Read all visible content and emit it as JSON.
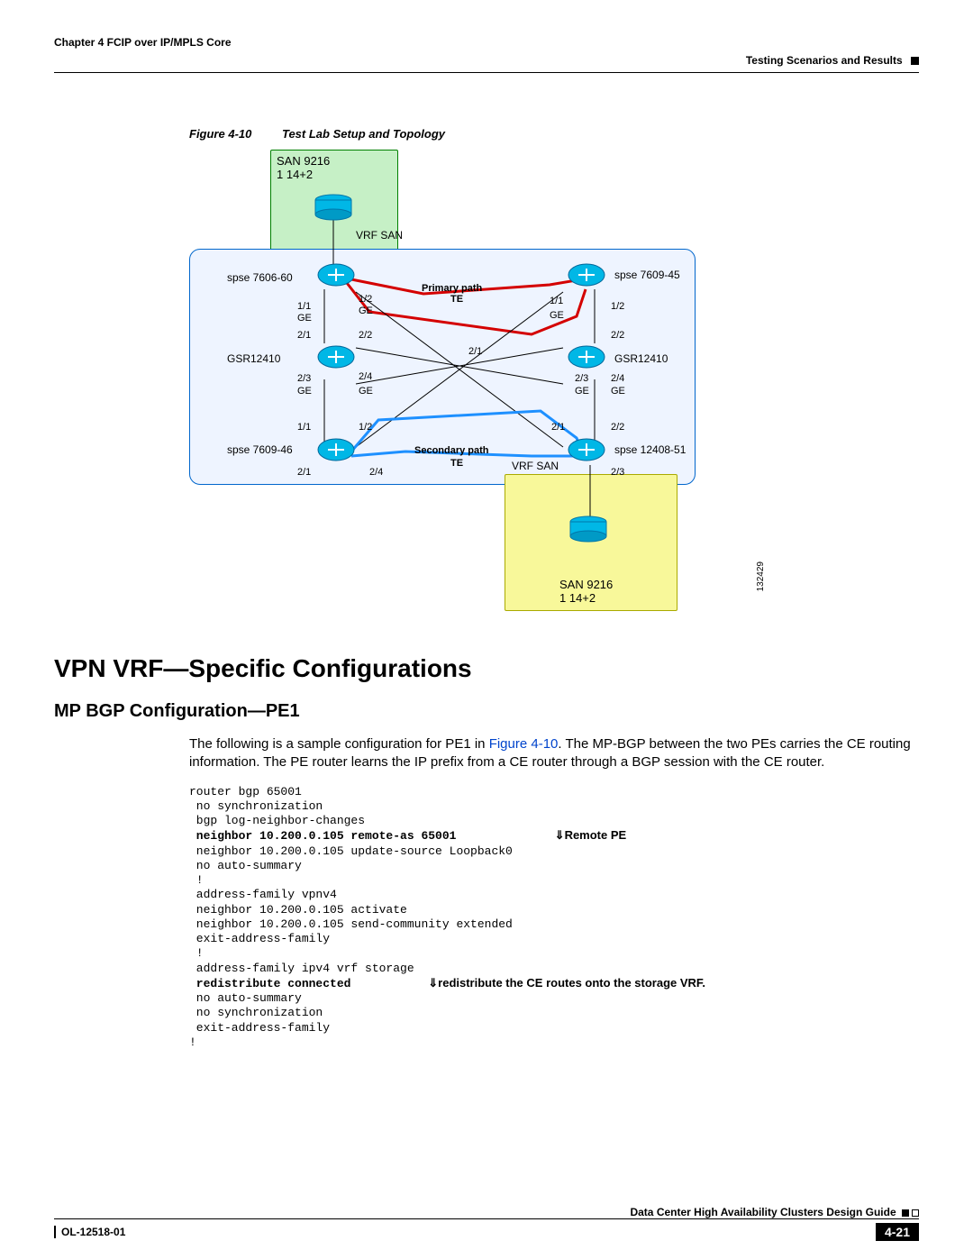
{
  "header": {
    "chapter": "Chapter 4      FCIP over IP/MPLS Core",
    "section": "Testing Scenarios and Results"
  },
  "figure": {
    "label": "Figure 4-10",
    "title": "Test Lab Setup and Topology",
    "image_id": "132429"
  },
  "diagram": {
    "san_top": "SAN 9216\n1 14+2",
    "vrf_san_top": "VRF SAN",
    "spse_7606_60": "spse 7606-60",
    "spse_7609_45": "spse 7609-45",
    "spse_7609_46": "spse 7609-46",
    "spse_12408_51": "spse 12408-51",
    "gsr_left": "GSR12410",
    "gsr_right": "GSR12410",
    "primary_path": "Primary path",
    "secondary_path": "Secondary path",
    "te1": "TE",
    "te2": "TE",
    "vrf_san_bottom": "VRF SAN",
    "san_bottom": "SAN 9216\n1 14+2",
    "ports": {
      "p11a": "1/1",
      "p12a": "1/2",
      "p21a": "2/1",
      "p22a": "2/2",
      "p11b": "1/1",
      "p12b": "1/2",
      "p22b": "2/2",
      "p23a": "2/3",
      "p24a": "2/4",
      "p21c": "2/1",
      "p23b": "2/3",
      "p24b": "2/4",
      "p11c": "1/1",
      "p12c": "1/2",
      "p21d": "2/1",
      "p22c": "2/2",
      "p21e": "2/1",
      "p24c": "2/4",
      "p23c": "2/3",
      "ge1": "GE",
      "ge2": "GE",
      "ge3": "GE",
      "ge4": "GE",
      "ge5": "GE",
      "ge6": "GE",
      "ge7": "GE",
      "ge8": "GE"
    }
  },
  "section_title": "VPN VRF—Specific Configurations",
  "subsection_title": "MP BGP Configuration—PE1",
  "paragraph": {
    "pre": "The following is a sample configuration for PE1 in ",
    "link": "Figure 4-10",
    "post": ". The MP-BGP between the two PEs carries the CE routing information. The PE router learns the IP prefix from a CE router through a BGP session with the CE router."
  },
  "config": {
    "l1": "router bgp 65001",
    "l2": " no synchronization",
    "l3": " bgp log-neighbor-changes",
    "l4b": " neighbor 10.200.0.105 remote-as 65001",
    "l4r": "⇓Remote PE",
    "l5": " neighbor 10.200.0.105 update-source Loopback0",
    "l6": " no auto-summary",
    "l7": " !",
    "l8": " address-family vpnv4",
    "l9": " neighbor 10.200.0.105 activate",
    "l10": " neighbor 10.200.0.105 send-community extended",
    "l11": " exit-address-family",
    "l12": " !",
    "l13": " address-family ipv4 vrf storage",
    "l14b": " redistribute connected",
    "l14r": "⇓redistribute the CE routes onto the storage VRF.",
    "l15": " no auto-summary",
    "l16": " no synchronization",
    "l17": " exit-address-family",
    "l18": "!"
  },
  "footer": {
    "guide": "Data Center High Availability Clusters Design Guide",
    "doc_id": "OL-12518-01",
    "page": "4-21"
  }
}
